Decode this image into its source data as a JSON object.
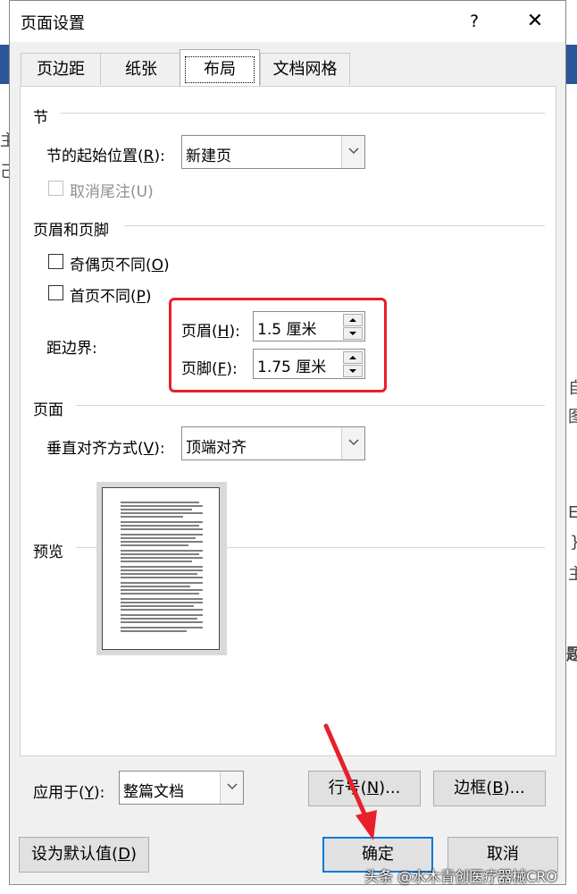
{
  "dialog": {
    "title": "页面设置",
    "help_label": "?",
    "close_label": "✕"
  },
  "tabs": [
    {
      "label": "页边距"
    },
    {
      "label": "纸张"
    },
    {
      "label": "布局",
      "active": true
    },
    {
      "label": "文档网格"
    }
  ],
  "section": {
    "title": "节",
    "start_label_pre": "节的起始位置(",
    "start_label_key": "R",
    "start_label_post": "):",
    "start_value": "新建页",
    "suppress_endnotes_pre": "取消尾注(U)"
  },
  "headers_footers": {
    "title": "页眉和页脚",
    "odd_even_pre": "奇偶页不同(",
    "odd_even_key": "O",
    "odd_even_post": ")",
    "first_page_pre": "首页不同(",
    "first_page_key": "P",
    "first_page_post": ")",
    "from_edge_label": "距边界:",
    "header_label_pre": "页眉(",
    "header_label_key": "H",
    "header_label_post": "):",
    "header_value": "1.5 厘米",
    "footer_label_pre": "页脚(",
    "footer_label_key": "F",
    "footer_label_post": "):",
    "footer_value": "1.75 厘米"
  },
  "page": {
    "title": "页面",
    "valign_label_pre": "垂直对齐方式(",
    "valign_label_key": "V",
    "valign_label_post": "):",
    "valign_value": "顶端对齐"
  },
  "preview": {
    "title": "预览"
  },
  "apply": {
    "label_pre": "应用于(",
    "label_key": "Y",
    "label_post": "):",
    "value": "整篇文档"
  },
  "buttons": {
    "line_numbers_pre": "行号(",
    "line_numbers_key": "N",
    "line_numbers_post": ")...",
    "borders_pre": "边框(",
    "borders_key": "B",
    "borders_post": ")...",
    "set_default_pre": "设为默认值(",
    "set_default_key": "D",
    "set_default_post": ")",
    "ok": "确定",
    "cancel": "取消"
  },
  "background_glyphs": {
    "right": [
      "自",
      "图",
      "E",
      "}",
      "主",
      "题"
    ],
    "left": [
      "主",
      "己"
    ]
  },
  "watermark": "头条 @水木青创医疗器械CRO",
  "colors": {
    "highlight_box": "#e8202a",
    "arrow": "#e8202a",
    "primary_border": "#0078d7"
  }
}
